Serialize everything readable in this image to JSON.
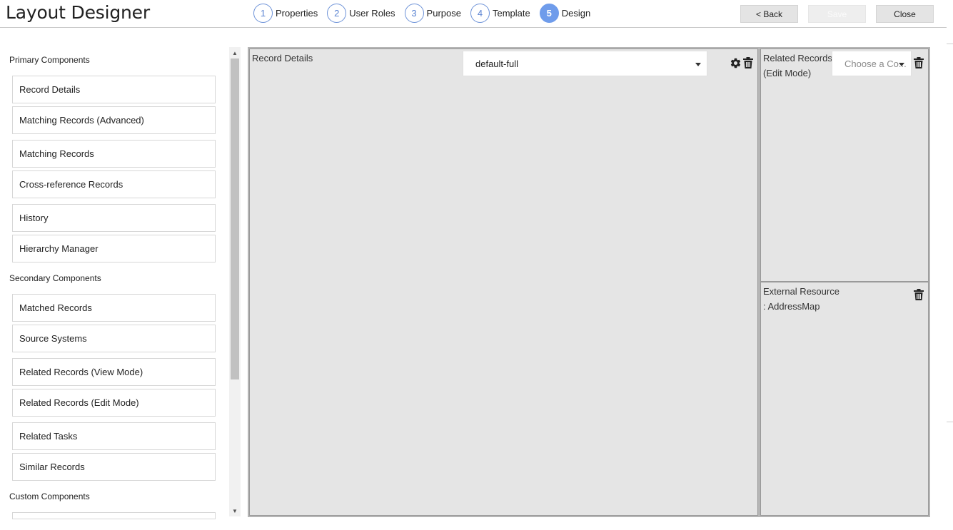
{
  "header": {
    "title": "Layout Designer",
    "steps": [
      {
        "number": "1",
        "label": "Properties"
      },
      {
        "number": "2",
        "label": "User Roles"
      },
      {
        "number": "3",
        "label": "Purpose"
      },
      {
        "number": "4",
        "label": "Template"
      },
      {
        "number": "5",
        "label": "Design"
      }
    ],
    "active_step": "5",
    "buttons": {
      "back": "< Back",
      "save": "Save",
      "close": "Close"
    }
  },
  "sidebar": {
    "primary_title": "Primary Components",
    "primary": [
      "Record Details",
      "Matching Records (Advanced)",
      "Matching Records",
      "Cross-reference Records",
      "History",
      "Hierarchy Manager"
    ],
    "secondary_title": "Secondary Components",
    "secondary": [
      "Matched Records",
      "Source Systems",
      "Related Records (View Mode)",
      "Related Records (Edit Mode)",
      "Related Tasks",
      "Similar Records"
    ],
    "custom_title": "Custom Components"
  },
  "canvas": {
    "main": {
      "label": "Record Details",
      "select_value": "default-full",
      "icons": [
        "gear-icon",
        "trash-icon"
      ]
    },
    "side_top": {
      "label_line1": "Related Records",
      "label_line2": "(Edit Mode)",
      "select_placeholder": "Choose a Co...",
      "icons": [
        "trash-icon"
      ]
    },
    "side_bottom": {
      "label_line1": "External Resource",
      "label_line2": ": AddressMap",
      "icons": [
        "trash-icon"
      ]
    }
  },
  "colors": {
    "accent": "#6f9ceb",
    "zone_bg": "#e5e5e5",
    "zone_border": "#9a9a9a",
    "button_bg": "#e4e4e4"
  }
}
